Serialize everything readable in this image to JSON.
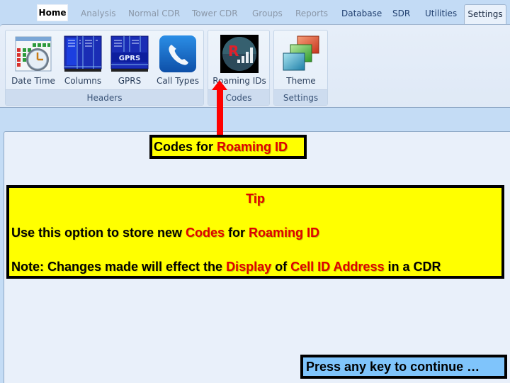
{
  "tabs": [
    {
      "label": "Home",
      "state": "highlighted"
    },
    {
      "label": "Analysis",
      "state": "disabled"
    },
    {
      "label": "Normal CDR",
      "state": "disabled"
    },
    {
      "label": "Tower CDR",
      "state": "disabled"
    },
    {
      "label": "Groups",
      "state": "disabled"
    },
    {
      "label": "Reports",
      "state": "disabled"
    },
    {
      "label": "Database",
      "state": "enabled"
    },
    {
      "label": "SDR",
      "state": "enabled"
    },
    {
      "label": "Utilities",
      "state": "enabled"
    },
    {
      "label": "Settings",
      "state": "active"
    }
  ],
  "ribbon": {
    "groups": [
      {
        "label": "Headers",
        "buttons": [
          {
            "label": "Date Time",
            "icon": "calendar-clock-icon"
          },
          {
            "label": "Columns",
            "icon": "columns-icon"
          },
          {
            "label": "GPRS",
            "icon": "gprs-icon",
            "icon_text": "GPRS"
          },
          {
            "label": "Call Types",
            "icon": "phone-icon"
          }
        ]
      },
      {
        "label": "Codes",
        "buttons": [
          {
            "label": "Roaming IDs",
            "icon": "roaming-signal-icon",
            "icon_text": "R"
          }
        ]
      },
      {
        "label": "Settings",
        "buttons": [
          {
            "label": "Theme",
            "icon": "theme-icon"
          }
        ]
      }
    ]
  },
  "callout": {
    "prefix": "Codes for ",
    "highlight": "Roaming ID"
  },
  "tip": {
    "title": "Tip",
    "line1": [
      {
        "text": "Use this option to store new ",
        "highlight": false
      },
      {
        "text": "Codes",
        "highlight": true
      },
      {
        "text": " for ",
        "highlight": false
      },
      {
        "text": "Roaming ID",
        "highlight": true
      }
    ],
    "line2": [
      {
        "text": "Note: Changes made will effect the ",
        "highlight": false
      },
      {
        "text": "Display",
        "highlight": true
      },
      {
        "text": " of ",
        "highlight": false
      },
      {
        "text": "Cell ID Address",
        "highlight": true
      },
      {
        "text": " in a CDR",
        "highlight": false
      }
    ]
  },
  "continue_prompt": "Press any key to continue …",
  "colors": {
    "highlight_text": "#e00000",
    "callout_bg": "#ffff00",
    "continue_bg": "#7fc4fb",
    "arrow": "#ff0000"
  }
}
